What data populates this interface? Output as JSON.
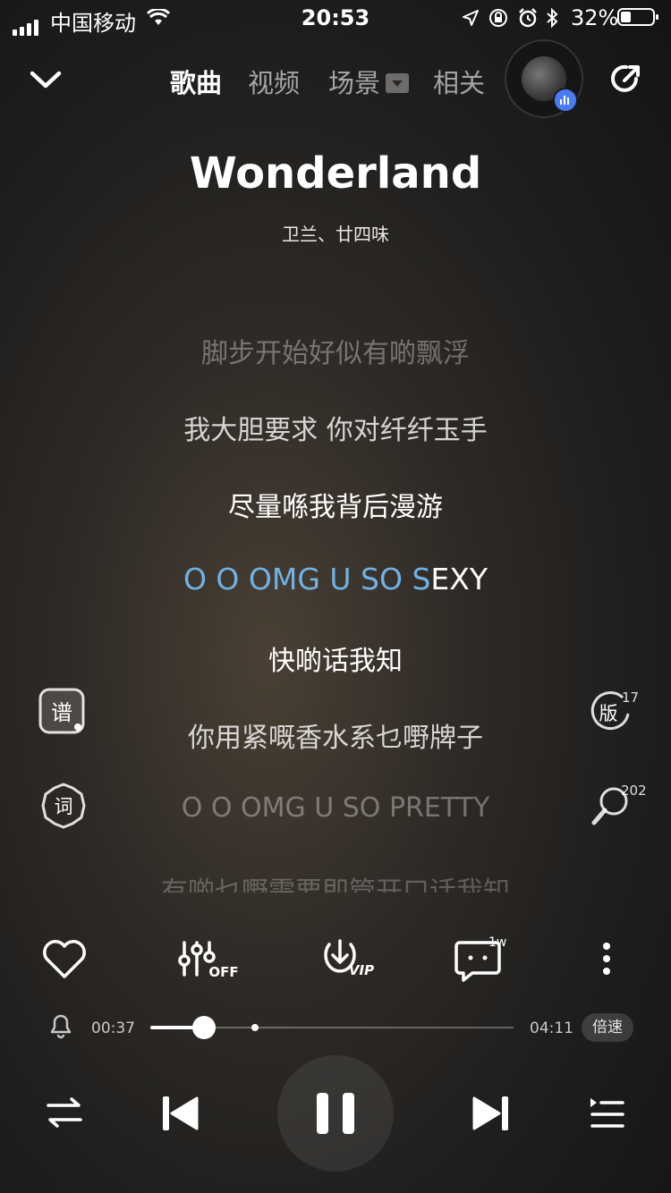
{
  "status_bar": {
    "carrier": "中国移动",
    "time": "20:53",
    "battery_percent": "32%",
    "battery_level": 0.32
  },
  "nav": {
    "tabs": [
      {
        "label": "歌曲",
        "active": true
      },
      {
        "label": "视频",
        "active": false
      },
      {
        "label": "场景",
        "active": false
      },
      {
        "label": "相关",
        "active": false
      }
    ]
  },
  "song": {
    "title": "Wonderland",
    "artist": "卫兰、廿四味"
  },
  "lyrics": {
    "lines": [
      "脚步开始好似有啲飘浮",
      "我大胆要求 你对纤纤玉手",
      "尽量喺我背后漫游",
      "O O OMG U SO SEXY",
      "快啲话我知",
      "你用紧嘅香水系乜嘢牌子",
      "O O OMG U SO PRETTY",
      "有啲乜嘢需要即管开口话我知"
    ],
    "current_sung": "O O OMG U SO S",
    "current_rest": "EXY"
  },
  "side": {
    "version_count": "17",
    "search_count": "202"
  },
  "controls": {
    "comment_count": "1w",
    "eq_label": "OFF",
    "download_label": "VIP"
  },
  "progress": {
    "current": "00:37",
    "total": "04:11",
    "fraction": 0.147,
    "speed_label": "倍速"
  },
  "icons": [
    "collapse-chevron-icon",
    "share-icon",
    "score-icon",
    "lyrics-icon",
    "version-icon",
    "search-icon",
    "heart-icon",
    "equalizer-icon",
    "download-icon",
    "comment-icon",
    "more-icon",
    "alarm-icon",
    "repeat-icon",
    "prev-icon",
    "pause-icon",
    "next-icon",
    "playlist-icon"
  ],
  "colors": {
    "highlight": "#6fb3e6",
    "badge": "#4a7cf7"
  }
}
